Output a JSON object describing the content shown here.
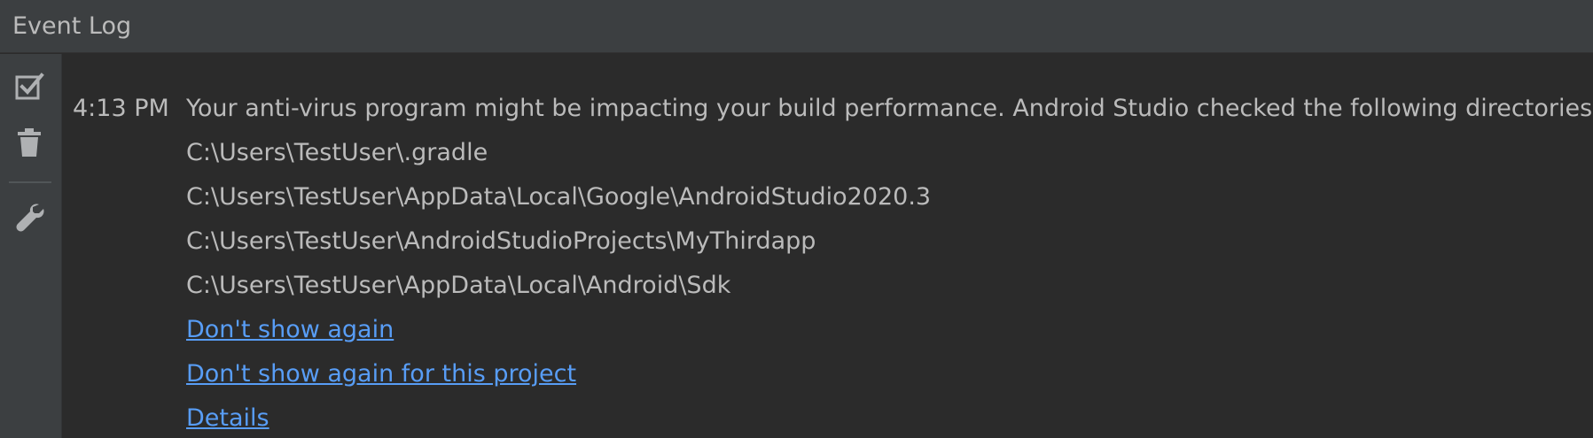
{
  "window": {
    "title": "Event Log"
  },
  "toolbar": {
    "items": [
      {
        "icon": "checkbox-icon",
        "tooltip": ""
      },
      {
        "icon": "trash-icon",
        "tooltip": ""
      },
      {
        "icon": "wrench-icon",
        "tooltip": ""
      }
    ]
  },
  "log": {
    "entry": {
      "time": "4:13 PM",
      "message": "Your anti-virus program might be impacting your build performance. Android Studio checked the following directories:",
      "directories": [
        "C:\\Users\\TestUser\\.gradle",
        "C:\\Users\\TestUser\\AppData\\Local\\Google\\AndroidStudio2020.3",
        "C:\\Users\\TestUser\\AndroidStudioProjects\\MyThirdapp",
        "C:\\Users\\TestUser\\AppData\\Local\\Android\\Sdk"
      ],
      "links": {
        "dont_show_again": "Don't show again",
        "dont_show_again_project": "Don't show again for this project",
        "details": "Details"
      }
    }
  },
  "colors": {
    "background": "#2b2b2b",
    "panel": "#3c3f41",
    "text": "#bbbbbb",
    "link": "#589df6"
  }
}
